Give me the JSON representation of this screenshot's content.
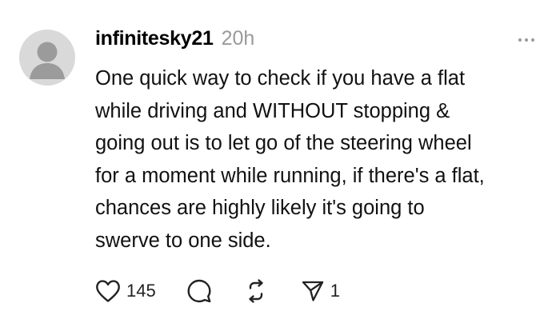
{
  "post": {
    "username": "infinitesky21",
    "timestamp": "20h",
    "text": "One quick way to check if you have a flat\nwhile driving and WITHOUT stopping &\ngoing out is to let go of the steering wheel\nfor a moment while running, if there's a flat,\nchances are highly likely it's going to\nswerve to one side.",
    "actions": {
      "like_count": "145",
      "share_count": "1"
    }
  },
  "icons": {
    "avatar": "default-user-avatar",
    "more": "more-horizontal-icon",
    "like": "heart-icon",
    "comment": "comment-bubble-icon",
    "repost": "repost-icon",
    "share": "send-icon"
  },
  "colors": {
    "text": "#111111",
    "muted": "#9a9a9a",
    "avatar_bg": "#d9d9d9",
    "avatar_fg": "#9b9b9b"
  }
}
